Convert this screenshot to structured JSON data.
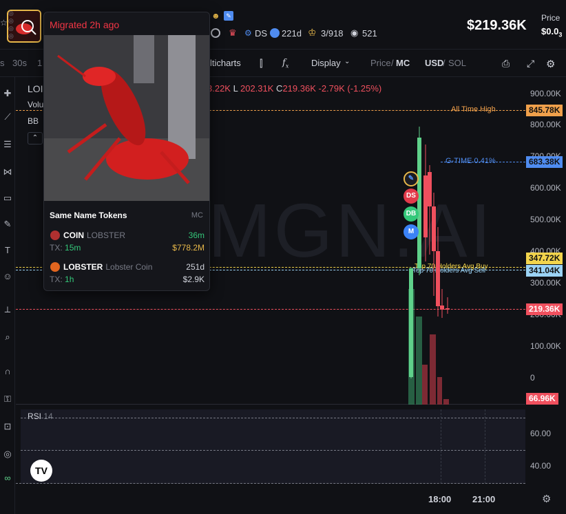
{
  "header": {
    "price_usd": "$219.36K",
    "price_label": "Price",
    "price_sol_prefix": "$0.0",
    "price_sol_sub": "3",
    "ds_label": "DS",
    "age": "221d",
    "holders": "3/918",
    "views": "521"
  },
  "toolbar": {
    "intervals": [
      "s",
      "30s",
      "1"
    ],
    "multicharts": "lticharts",
    "display": "Display",
    "price": "Price",
    "mc": "MC",
    "usd": "USD",
    "sol": "SOL"
  },
  "legend": {
    "symbol": "LOI",
    "volume": "Volu",
    "bb": "BB",
    "ohlc_h": "3.22K",
    "ohlc_l_label": "L",
    "ohlc_l": "202.31K",
    "ohlc_c_label": "C",
    "ohlc_c": "219.36K",
    "change": "-2.79K (-1.25%)"
  },
  "watermark": "MGN.AI",
  "y_axis": [
    "900.00K",
    "800.00K",
    "700.00K",
    "600.00K",
    "500.00K",
    "400.00K",
    "300.00K",
    "200.00K",
    "100.00K",
    "0"
  ],
  "tags": {
    "ath_label": "All Time High",
    "ath_value": "845.78K",
    "gtime_label": "G-TIME 0.41%",
    "gtime_value": "683.38K",
    "avg_buy_label": "Top 70 Holders Avg Buy",
    "avg_sell_label": "Top 70 Holders Avg Sell",
    "avg_buy_value": "347.72K",
    "avg_sell_value": "341.04K",
    "current_value": "219.36K",
    "volume_value": "66.96K"
  },
  "rsi": {
    "label": "RSI",
    "period": "14",
    "ticks": [
      "60.00",
      "40.00"
    ]
  },
  "x_axis": [
    "18:00",
    "21:00"
  ],
  "markers": [
    "DS",
    "DB",
    "M"
  ],
  "popup": {
    "title": "Migrated 2h ago",
    "section": "Same Name Tokens",
    "mc_header": "MC",
    "tokens": [
      {
        "symbol": "COIN",
        "name": "LOBSTER",
        "age": "36m",
        "tx_label": "TX:",
        "tx": "15m",
        "mc": "$778.2M"
      },
      {
        "symbol": "LOBSTER",
        "name": "Lobster Coin",
        "age": "251d",
        "tx_label": "TX:",
        "tx": "1h",
        "mc": "$2.9K"
      }
    ]
  },
  "colors": {
    "up": "#5fd18a",
    "down": "#f0505e",
    "ath": "#f0a04b",
    "gtime": "#4f8cf0",
    "avg_buy": "#f2d44c",
    "avg_sell": "#9bd3f5"
  }
}
